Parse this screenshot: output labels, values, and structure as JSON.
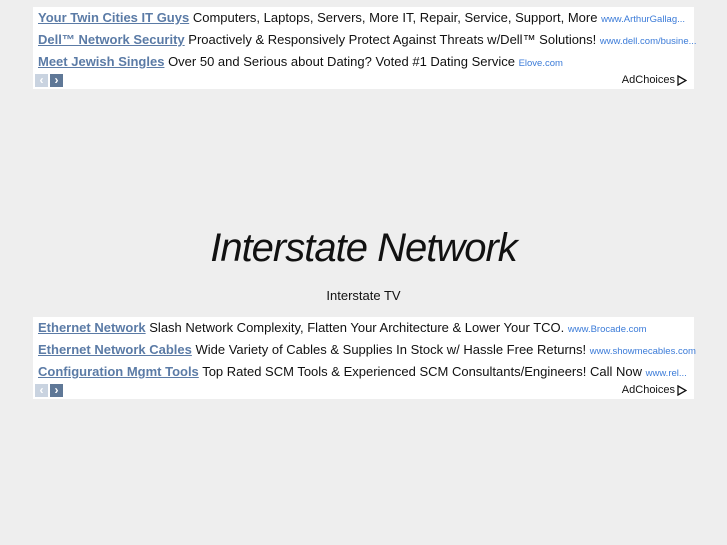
{
  "ad_blocks": [
    {
      "ads": [
        {
          "title": "Your Twin Cities IT Guys",
          "text": "Computers, Laptops, Servers, More IT, Repair, Service, Support, More",
          "url": "www.ArthurGallag..."
        },
        {
          "title": "Dell™ Network Security",
          "text": "Proactively & Responsively Protect Against Threats w/Dell™ Solutions!",
          "url": "www.dell.com/busine..."
        },
        {
          "title": "Meet Jewish Singles",
          "text": "Over 50 and Serious about Dating? Voted #1 Dating Service",
          "url": "Elove.com"
        }
      ],
      "adchoices": "AdChoices"
    },
    {
      "ads": [
        {
          "title": "Ethernet Network",
          "text": "Slash Network Complexity, Flatten Your Architecture & Lower Your TCO.",
          "url": "www.Brocade.com"
        },
        {
          "title": "Ethernet Network Cables",
          "text": "Wide Variety of Cables & Supplies In Stock w/ Hassle Free Returns!",
          "url": "www.showmecables.com"
        },
        {
          "title": "Configuration Mgmt Tools",
          "text": "Top Rated SCM Tools & Experienced SCM Consultants/Engineers! Call Now",
          "url": "www.rel..."
        }
      ],
      "adchoices": "AdChoices"
    }
  ],
  "nav": {
    "prev": "‹",
    "next": "›"
  },
  "site_title": "Interstate Network",
  "subtitle": "Interstate TV"
}
